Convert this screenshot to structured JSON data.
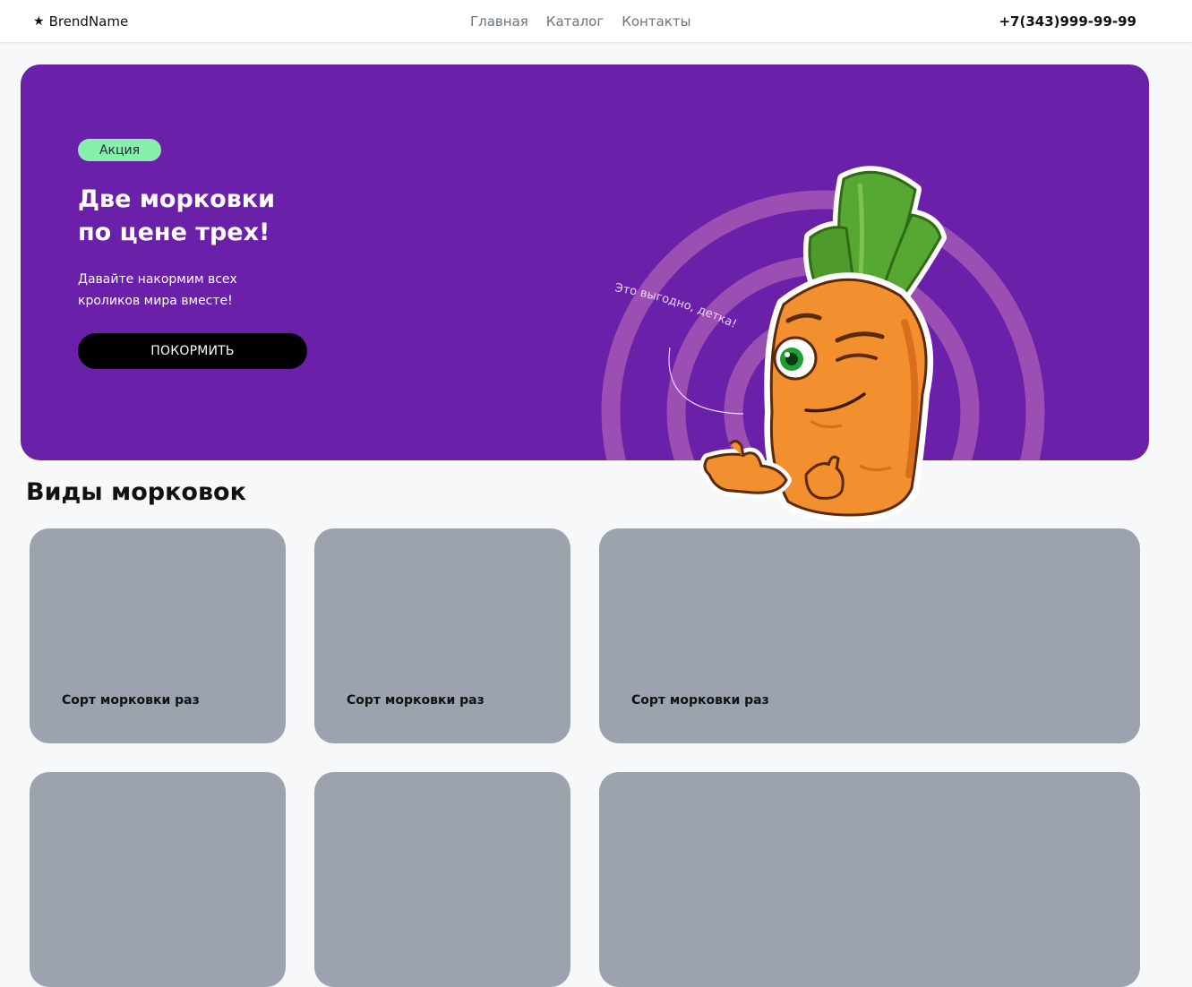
{
  "header": {
    "brand": "BrendName",
    "brand_icon": "star-icon",
    "nav": [
      "Главная",
      "Каталог",
      "Контакты"
    ],
    "phone": "+7(343)999-99-99"
  },
  "hero": {
    "badge": "Акция",
    "title_line1": "Две морковки",
    "title_line2": "по цене трех!",
    "subtitle_line1": "Давайте накормим всех",
    "subtitle_line2": "кроликов мира вместе!",
    "button": "ПОКОРМИТЬ",
    "curved_caption": "Это выгодно, детка!",
    "colors": {
      "background": "#6a20a9",
      "badge": "#86efac",
      "arcs": "#9b4fb3",
      "button": "#000000"
    }
  },
  "section": {
    "title": "Виды морковок",
    "cards": [
      {
        "label": "Сорт морковки раз"
      },
      {
        "label": "Сорт морковки раз"
      },
      {
        "label": "Сорт морковки раз"
      },
      {
        "label": ""
      },
      {
        "label": ""
      },
      {
        "label": ""
      }
    ],
    "card_color": "#9ca3af"
  }
}
